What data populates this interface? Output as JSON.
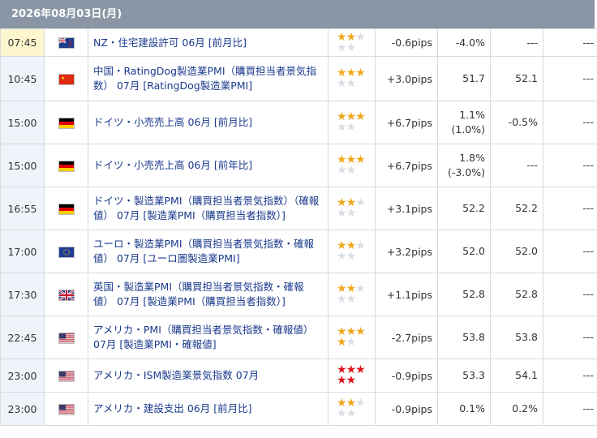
{
  "date_header": "2026年08月03日(月)",
  "colors": {
    "header_bg": "#8a96a6",
    "star_gold": "#f0a81a",
    "star_red": "#e0141e",
    "star_empty": "#d9dde4",
    "event_text": "#1a3a8c"
  },
  "rows": [
    {
      "time": "07:45",
      "flag": "nz-flag-icon",
      "event": "NZ・住宅建設許可 06月 [前月比]",
      "stars": 2,
      "star_color": "gold",
      "pips": "-0.6pips",
      "prev": "-4.0%",
      "prev2": "",
      "fore": "---",
      "res": "---",
      "highlight": true
    },
    {
      "time": "10:45",
      "flag": "cn-flag-icon",
      "event": "中国・RatingDog製造業PMI（購買担当者景気指数） 07月 [RatingDog製造業PMI]",
      "stars": 3,
      "star_color": "gold",
      "pips": "+3.0pips",
      "prev": "51.7",
      "prev2": "",
      "fore": "52.1",
      "res": "---",
      "highlight": false
    },
    {
      "time": "15:00",
      "flag": "de-flag-icon",
      "event": "ドイツ・小売売上高 06月 [前月比]",
      "stars": 3,
      "star_color": "gold",
      "pips": "+6.7pips",
      "prev": "1.1%",
      "prev2": "(1.0%)",
      "fore": "-0.5%",
      "res": "---",
      "highlight": false
    },
    {
      "time": "15:00",
      "flag": "de-flag-icon",
      "event": "ドイツ・小売売上高 06月 [前年比]",
      "stars": 3,
      "star_color": "gold",
      "pips": "+6.7pips",
      "prev": "1.8%",
      "prev2": "(-3.0%)",
      "fore": "---",
      "res": "---",
      "highlight": false
    },
    {
      "time": "16:55",
      "flag": "de-flag-icon",
      "event": "ドイツ・製造業PMI（購買担当者景気指数）（確報値） 07月 [製造業PMI（購買担当者指数）]",
      "stars": 2,
      "star_color": "gold",
      "pips": "+3.1pips",
      "prev": "52.2",
      "prev2": "",
      "fore": "52.2",
      "res": "---",
      "highlight": false
    },
    {
      "time": "17:00",
      "flag": "eu-flag-icon",
      "event": "ユーロ・製造業PMI（購買担当者景気指数・確報値） 07月 [ユーロ圏製造業PMI]",
      "stars": 2,
      "star_color": "gold",
      "pips": "+3.2pips",
      "prev": "52.0",
      "prev2": "",
      "fore": "52.0",
      "res": "---",
      "highlight": false
    },
    {
      "time": "17:30",
      "flag": "uk-flag-icon",
      "event": "英国・製造業PMI（購買担当者景気指数・確報値） 07月 [製造業PMI（購買担当者指数）]",
      "stars": 2,
      "star_color": "gold",
      "pips": "+1.1pips",
      "prev": "52.8",
      "prev2": "",
      "fore": "52.8",
      "res": "---",
      "highlight": false
    },
    {
      "time": "22:45",
      "flag": "us-flag-icon",
      "event": "アメリカ・PMI（購買担当者景気指数・確報値） 07月 [製造業PMI・確報値]",
      "stars": 4,
      "star_color": "gold",
      "pips": "-2.7pips",
      "prev": "53.8",
      "prev2": "",
      "fore": "53.8",
      "res": "---",
      "highlight": false
    },
    {
      "time": "23:00",
      "flag": "us-flag-icon",
      "event": "アメリカ・ISM製造業景気指数 07月",
      "stars": 5,
      "star_color": "red",
      "pips": "-0.9pips",
      "prev": "53.3",
      "prev2": "",
      "fore": "54.1",
      "res": "---",
      "highlight": false
    },
    {
      "time": "23:00",
      "flag": "us-flag-icon",
      "event": "アメリカ・建設支出 06月 [前月比]",
      "stars": 2,
      "star_color": "gold",
      "pips": "-0.9pips",
      "prev": "0.1%",
      "prev2": "",
      "fore": "0.2%",
      "res": "---",
      "highlight": false
    }
  ]
}
